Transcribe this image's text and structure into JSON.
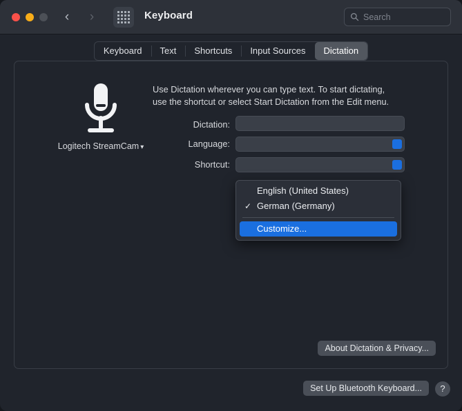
{
  "window": {
    "title": "Keyboard",
    "traffic_lights": [
      "close",
      "minimize",
      "zoom"
    ],
    "back_icon": "chevron-left-icon",
    "forward_icon": "chevron-right-icon",
    "grid_icon": "show-all-grid-icon"
  },
  "search": {
    "placeholder": "Search",
    "icon": "search-icon"
  },
  "tabs": [
    {
      "label": "Keyboard",
      "selected": false
    },
    {
      "label": "Text",
      "selected": false
    },
    {
      "label": "Shortcuts",
      "selected": false
    },
    {
      "label": "Input Sources",
      "selected": false
    },
    {
      "label": "Dictation",
      "selected": true
    }
  ],
  "dictation": {
    "mic_icon": "microphone-icon",
    "device": "Logitech StreamCam",
    "device_chevron": "chevron-down-icon",
    "description_line1": "Use Dictation wherever you can type text. To start dictating,",
    "description_line2": "use the shortcut or select Start Dictation from the Edit menu.",
    "labels": {
      "dictation": "Dictation:",
      "language": "Language:",
      "shortcut": "Shortcut:"
    }
  },
  "language_menu": {
    "items": [
      {
        "label": "English (United States)",
        "checked": false,
        "highlighted": false
      },
      {
        "label": "German (Germany)",
        "checked": true,
        "highlighted": false
      }
    ],
    "check_glyph": "✓",
    "separator": true,
    "customize_label": "Customize...",
    "highlight_color": "#1a6fe0"
  },
  "buttons": {
    "about_privacy": "About Dictation & Privacy...",
    "bluetooth_keyboard": "Set Up Bluetooth Keyboard...",
    "help": "?"
  }
}
